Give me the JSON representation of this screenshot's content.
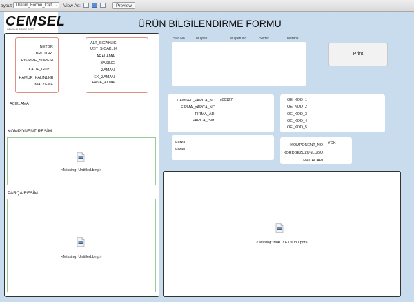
{
  "toolbar": {
    "layout_label": "ayout:",
    "layout_value": "Uretim_Formu_Cikti",
    "view_as_label": "View As:",
    "preview_label": "Preview"
  },
  "logo": {
    "text": "CEMSEL",
    "tagline": "ORIGINAL SPARE PART"
  },
  "title": "ÜRÜN BİLGİLENDİRME FORMU",
  "left_fields_1": [
    "NETGR",
    "BRUTGR",
    "PISIRME_SURESI",
    "KALIP_GOZU",
    "HAMUR_KALINLIGI",
    "MALZEME"
  ],
  "left_fields_2": [
    "ALT_SICAKLIK",
    "UST_SICAKLIK",
    "ARALAMA",
    "BASINC",
    "ZAMAN",
    "EK_ZAMAN",
    "HAVA_ALMA"
  ],
  "aciklama_label": "ACIKLAMA",
  "komponent_resim_label": "KOMPONENT RESİM",
  "komponent_missing": "<Missing: Untitled.bmp>",
  "parca_resim_label": "PARÇA RESİM",
  "parca_missing": "<Missing: Untitled.bmp>",
  "order_headers": [
    "Sira No",
    "Müşteri",
    "Müşteri No",
    "Sertlik",
    "Tblerans"
  ],
  "print_label": "Print",
  "parca_fields": [
    "CEMSEL_PARCA_NO",
    "FIRMA_pARCA_NO",
    "FIRMA_ADI",
    "PARCA_ISMI"
  ],
  "parca_no_value": "m00127",
  "oe_fields": [
    "OE_KOD_1",
    "OE_KOD_2",
    "OE_KOD_3",
    "OE_KOD_4",
    "OE_KOD_5"
  ],
  "marka_label": "Marka",
  "model_label": "Model",
  "komponent_fields": [
    "KOMPONENT_NO",
    "KORDBEZUZUNLUGU",
    "MACACAPI"
  ],
  "komponent_no_value": "YOK",
  "maliyet_missing": "<Missing: MALİYET sunu.pdf>",
  "colors": {
    "background": "#c9dced",
    "red_border": "#e09080",
    "green_border": "#96cc96"
  },
  "icons": [
    "missing-file-icon",
    "pdf-file-icon"
  ]
}
